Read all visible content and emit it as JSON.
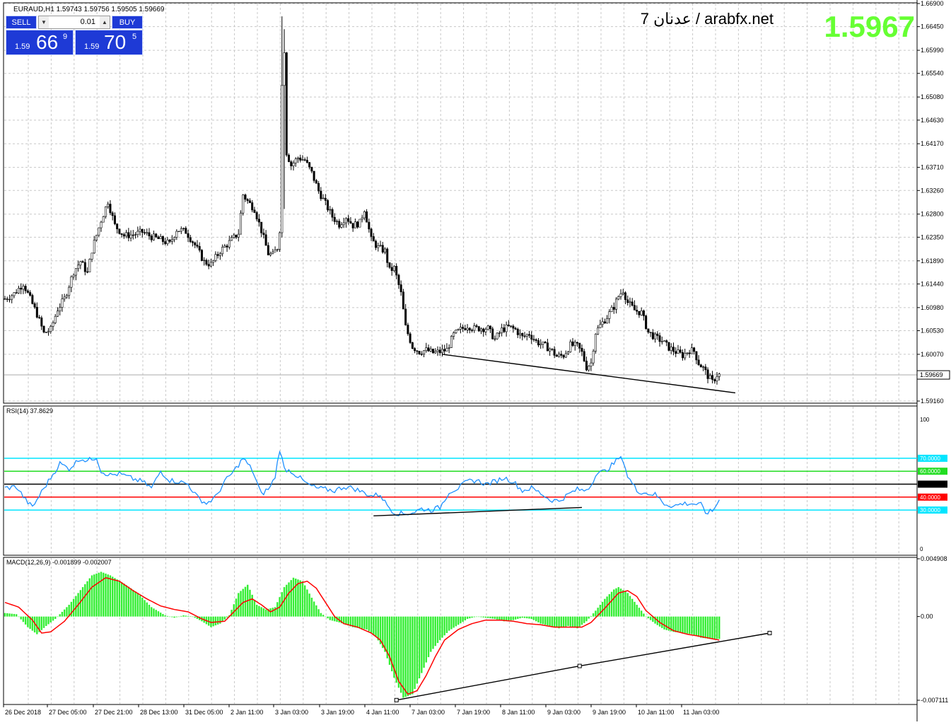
{
  "header": {
    "symbol_info": "EURAUD,H1  1.59743 1.59756 1.59505 1.59669",
    "watermark": "7 عدنان / arabfx.net",
    "big_price": "1.5967"
  },
  "trade_panel": {
    "sell_label": "SELL",
    "buy_label": "BUY",
    "lot": "0.01",
    "sell_prefix": "1.59",
    "sell_big": "66",
    "sell_sup": "9",
    "buy_prefix": "1.59",
    "buy_big": "70",
    "buy_sup": "5"
  },
  "colors": {
    "candle": "#000000",
    "grid": "#c8c8c8",
    "rsi_line": "#1e90ff",
    "level_70": "#00e5ff",
    "level_60": "#22dd22",
    "level_50": "#000000",
    "level_40": "#ff0000",
    "level_30": "#00e5ff",
    "macd_hist": "#33ee33",
    "macd_signal": "#ff0000",
    "big_price": "#66ff33"
  },
  "chart_data": [
    {
      "type": "candlestick",
      "title": "EURAUD,H1",
      "ylim": [
        1.5916,
        1.669
      ],
      "y_ticks": [
        "1.66900",
        "1.66450",
        "1.65990",
        "1.65540",
        "1.65080",
        "1.64630",
        "1.64170",
        "1.63710",
        "1.63260",
        "1.62800",
        "1.62350",
        "1.61890",
        "1.61440",
        "1.60980",
        "1.60530",
        "1.60070",
        "1.59160"
      ],
      "current_price": "1.59669",
      "x_ticks": [
        "26 Dec 2018",
        "27 Dec 05:00",
        "27 Dec 21:00",
        "28 Dec 13:00",
        "31 Dec 05:00",
        "2 Jan 11:00",
        "3 Jan 03:00",
        "3 Jan 19:00",
        "4 Jan 11:00",
        "7 Jan 03:00",
        "7 Jan 19:00",
        "8 Jan 11:00",
        "9 Jan 03:00",
        "9 Jan 19:00",
        "10 Jan 11:00",
        "11 Jan 03:00"
      ],
      "close_path": [
        [
          0,
          1.6115
        ],
        [
          4,
          1.6125
        ],
        [
          8,
          1.6145
        ],
        [
          12,
          1.6105
        ],
        [
          14,
          1.6085
        ],
        [
          17,
          1.6048
        ],
        [
          20,
          1.6055
        ],
        [
          23,
          1.6095
        ],
        [
          26,
          1.6115
        ],
        [
          30,
          1.6168
        ],
        [
          33,
          1.6188
        ],
        [
          36,
          1.6165
        ],
        [
          38,
          1.621
        ],
        [
          42,
          1.6268
        ],
        [
          45,
          1.6305
        ],
        [
          48,
          1.6258
        ],
        [
          52,
          1.6238
        ],
        [
          56,
          1.624
        ],
        [
          60,
          1.6245
        ],
        [
          64,
          1.6236
        ],
        [
          68,
          1.623
        ],
        [
          72,
          1.6222
        ],
        [
          75,
          1.625
        ],
        [
          79,
          1.6246
        ],
        [
          83,
          1.622
        ],
        [
          87,
          1.6187
        ],
        [
          90,
          1.6182
        ],
        [
          94,
          1.6208
        ],
        [
          98,
          1.6225
        ],
        [
          102,
          1.6243
        ],
        [
          104,
          1.6318
        ],
        [
          106,
          1.6305
        ],
        [
          109,
          1.629
        ],
        [
          112,
          1.6248
        ],
        [
          115,
          1.6203
        ],
        [
          117,
          1.62
        ],
        [
          119,
          1.6215
        ],
        [
          120,
          1.625
        ],
        [
          121,
          1.653
        ],
        [
          122,
          1.66
        ],
        [
          123,
          1.64
        ],
        [
          125,
          1.6375
        ],
        [
          128,
          1.639
        ],
        [
          131,
          1.6385
        ],
        [
          134,
          1.636
        ],
        [
          137,
          1.6325
        ],
        [
          140,
          1.63
        ],
        [
          143,
          1.6275
        ],
        [
          146,
          1.626
        ],
        [
          149,
          1.6275
        ],
        [
          152,
          1.6258
        ],
        [
          155,
          1.6263
        ],
        [
          157,
          1.629
        ],
        [
          160,
          1.623
        ],
        [
          163,
          1.6215
        ],
        [
          166,
          1.6208
        ],
        [
          168,
          1.617
        ],
        [
          170,
          1.6175
        ],
        [
          173,
          1.6125
        ],
        [
          175,
          1.606
        ],
        [
          178,
          1.6022
        ],
        [
          181,
          1.6012
        ],
        [
          184,
          1.6015
        ],
        [
          187,
          1.601
        ],
        [
          190,
          1.6012
        ],
        [
          193,
          1.6016
        ],
        [
          196,
          1.6045
        ],
        [
          199,
          1.6055
        ],
        [
          202,
          1.6063
        ],
        [
          205,
          1.6057
        ],
        [
          208,
          1.6058
        ],
        [
          211,
          1.6057
        ],
        [
          214,
          1.6036
        ],
        [
          217,
          1.6055
        ],
        [
          220,
          1.606
        ],
        [
          223,
          1.6055
        ],
        [
          226,
          1.604
        ],
        [
          229,
          1.6047
        ],
        [
          232,
          1.6032
        ],
        [
          235,
          1.6025
        ],
        [
          238,
          1.6018
        ],
        [
          241,
          1.6003
        ],
        [
          244,
          1.6005
        ],
        [
          247,
          1.6025
        ],
        [
          250,
          1.6023
        ],
        [
          252,
          1.601
        ],
        [
          254,
          1.5982
        ],
        [
          256,
          1.599
        ],
        [
          258,
          1.605
        ],
        [
          260,
          1.6063
        ],
        [
          263,
          1.608
        ],
        [
          266,
          1.61
        ],
        [
          268,
          1.612
        ],
        [
          270,
          1.6132
        ],
        [
          272,
          1.6108
        ],
        [
          275,
          1.6093
        ],
        [
          278,
          1.6088
        ],
        [
          281,
          1.605
        ],
        [
          284,
          1.604
        ],
        [
          287,
          1.6033
        ],
        [
          290,
          1.602
        ],
        [
          293,
          1.6012
        ],
        [
          296,
          1.6005
        ],
        [
          299,
          1.6015
        ],
        [
          301,
          1.6013
        ],
        [
          303,
          1.599
        ],
        [
          305,
          1.598
        ],
        [
          307,
          1.5965
        ],
        [
          309,
          1.5953
        ],
        [
          311,
          1.5967
        ]
      ],
      "trendline": [
        [
          191,
          1.6007
        ],
        [
          319,
          1.5932
        ]
      ],
      "horizontal_line": 1.59669
    },
    {
      "type": "line",
      "title": "RSI(14) 37.8629",
      "ylim": [
        0,
        100
      ],
      "y_ticks": [
        "100",
        "70.0000",
        "60.0000",
        "50.0000",
        "40.0000",
        "30.0000",
        "0"
      ],
      "levels": [
        70,
        60,
        50,
        40,
        30
      ],
      "values_path": [
        [
          0,
          47
        ],
        [
          5,
          48
        ],
        [
          9,
          38
        ],
        [
          12,
          32
        ],
        [
          16,
          44
        ],
        [
          20,
          55
        ],
        [
          24,
          66
        ],
        [
          28,
          62
        ],
        [
          33,
          70
        ],
        [
          36,
          68
        ],
        [
          40,
          71
        ],
        [
          42,
          60
        ],
        [
          46,
          57
        ],
        [
          50,
          58
        ],
        [
          56,
          54
        ],
        [
          60,
          52
        ],
        [
          64,
          47
        ],
        [
          68,
          60
        ],
        [
          72,
          53
        ],
        [
          76,
          52
        ],
        [
          80,
          50
        ],
        [
          84,
          40
        ],
        [
          88,
          35
        ],
        [
          92,
          40
        ],
        [
          96,
          52
        ],
        [
          100,
          60
        ],
        [
          104,
          70
        ],
        [
          108,
          61
        ],
        [
          112,
          42
        ],
        [
          116,
          48
        ],
        [
          118,
          56
        ],
        [
          120,
          77
        ],
        [
          122,
          62
        ],
        [
          125,
          60
        ],
        [
          128,
          56
        ],
        [
          132,
          50
        ],
        [
          136,
          47
        ],
        [
          140,
          46
        ],
        [
          144,
          45
        ],
        [
          148,
          48
        ],
        [
          152,
          47
        ],
        [
          156,
          44
        ],
        [
          160,
          41
        ],
        [
          164,
          42
        ],
        [
          166,
          36
        ],
        [
          170,
          28
        ],
        [
          174,
          27
        ],
        [
          178,
          28
        ],
        [
          182,
          31
        ],
        [
          186,
          30
        ],
        [
          190,
          32
        ],
        [
          194,
          44
        ],
        [
          198,
          47
        ],
        [
          202,
          52
        ],
        [
          206,
          53
        ],
        [
          210,
          50
        ],
        [
          214,
          52
        ],
        [
          218,
          55
        ],
        [
          222,
          52
        ],
        [
          226,
          45
        ],
        [
          230,
          47
        ],
        [
          234,
          43
        ],
        [
          238,
          38
        ],
        [
          242,
          37
        ],
        [
          246,
          42
        ],
        [
          250,
          46
        ],
        [
          253,
          45
        ],
        [
          256,
          49
        ],
        [
          258,
          58
        ],
        [
          262,
          60
        ],
        [
          266,
          66
        ],
        [
          268,
          70
        ],
        [
          270,
          69
        ],
        [
          272,
          56
        ],
        [
          276,
          45
        ],
        [
          280,
          43
        ],
        [
          284,
          42
        ],
        [
          288,
          35
        ],
        [
          292,
          33
        ],
        [
          296,
          35
        ],
        [
          300,
          35
        ],
        [
          304,
          34
        ],
        [
          306,
          28
        ],
        [
          309,
          29
        ],
        [
          312,
          37.8629
        ]
      ],
      "trendline": [
        [
          161,
          25.5
        ],
        [
          252,
          32
        ]
      ]
    },
    {
      "type": "bar",
      "title": "MACD(12,26,9) -0.001899 -0.002007",
      "ylim": [
        -0.007111,
        0.004908
      ],
      "y_ticks": [
        "0.004908",
        "0.00",
        "-0.007111"
      ],
      "histogram_path": [
        [
          0,
          0.0003
        ],
        [
          5,
          0.0002
        ],
        [
          10,
          -0.0009
        ],
        [
          14,
          -0.0015
        ],
        [
          18,
          -0.0008
        ],
        [
          22,
          -0.0002
        ],
        [
          28,
          0.001
        ],
        [
          34,
          0.0025
        ],
        [
          38,
          0.0035
        ],
        [
          42,
          0.0038
        ],
        [
          46,
          0.0035
        ],
        [
          52,
          0.0028
        ],
        [
          58,
          0.002
        ],
        [
          64,
          0.0008
        ],
        [
          70,
          0.0001
        ],
        [
          74,
          -0.0001
        ],
        [
          78,
          0.0001
        ],
        [
          82,
          0.0
        ],
        [
          86,
          -0.0004
        ],
        [
          90,
          -0.0009
        ],
        [
          94,
          -0.0006
        ],
        [
          98,
          0.0001
        ],
        [
          102,
          0.002
        ],
        [
          106,
          0.0027
        ],
        [
          110,
          0.001
        ],
        [
          114,
          0.0006
        ],
        [
          118,
          0.0008
        ],
        [
          122,
          0.0025
        ],
        [
          126,
          0.0033
        ],
        [
          130,
          0.003
        ],
        [
          134,
          0.0016
        ],
        [
          138,
          0.0003
        ],
        [
          142,
          -0.0003
        ],
        [
          146,
          -0.0005
        ],
        [
          152,
          -0.0009
        ],
        [
          158,
          -0.0011
        ],
        [
          162,
          -0.0017
        ],
        [
          166,
          -0.003
        ],
        [
          170,
          -0.0052
        ],
        [
          174,
          -0.0069
        ],
        [
          178,
          -0.0066
        ],
        [
          182,
          -0.0048
        ],
        [
          186,
          -0.003
        ],
        [
          190,
          -0.002
        ],
        [
          194,
          -0.0012
        ],
        [
          198,
          -0.0007
        ],
        [
          202,
          -0.0002
        ],
        [
          206,
          0.0
        ],
        [
          210,
          -0.0001
        ],
        [
          214,
          -0.0002
        ],
        [
          218,
          -0.0004
        ],
        [
          222,
          -0.0003
        ],
        [
          226,
          -0.0001
        ],
        [
          230,
          -0.0002
        ],
        [
          234,
          -0.0006
        ],
        [
          238,
          -0.0008
        ],
        [
          242,
          -0.001
        ],
        [
          246,
          -0.0008
        ],
        [
          250,
          -0.001
        ],
        [
          254,
          -0.0004
        ],
        [
          258,
          0.0005
        ],
        [
          262,
          0.0015
        ],
        [
          266,
          0.0023
        ],
        [
          268,
          0.0025
        ],
        [
          272,
          0.002
        ],
        [
          276,
          0.001
        ],
        [
          280,
          0.0
        ],
        [
          284,
          -0.0006
        ],
        [
          288,
          -0.0011
        ],
        [
          292,
          -0.0013
        ],
        [
          296,
          -0.0014
        ],
        [
          300,
          -0.0015
        ],
        [
          304,
          -0.0018
        ],
        [
          308,
          -0.0019
        ],
        [
          312,
          -0.0019
        ]
      ],
      "signal_path": [
        [
          0,
          0.0012
        ],
        [
          6,
          0.0008
        ],
        [
          12,
          -0.0003
        ],
        [
          16,
          -0.0014
        ],
        [
          20,
          -0.0013
        ],
        [
          26,
          -0.0004
        ],
        [
          32,
          0.001
        ],
        [
          38,
          0.0025
        ],
        [
          44,
          0.0033
        ],
        [
          50,
          0.003
        ],
        [
          56,
          0.0022
        ],
        [
          62,
          0.0015
        ],
        [
          68,
          0.0009
        ],
        [
          74,
          0.0006
        ],
        [
          80,
          0.0004
        ],
        [
          86,
          -0.0002
        ],
        [
          90,
          -0.0005
        ],
        [
          96,
          -0.0004
        ],
        [
          100,
          0.0004
        ],
        [
          104,
          0.0012
        ],
        [
          108,
          0.0015
        ],
        [
          112,
          0.001
        ],
        [
          116,
          0.0004
        ],
        [
          120,
          0.0008
        ],
        [
          124,
          0.002
        ],
        [
          128,
          0.0028
        ],
        [
          132,
          0.003
        ],
        [
          136,
          0.0024
        ],
        [
          140,
          0.0012
        ],
        [
          144,
          0.0
        ],
        [
          148,
          -0.0006
        ],
        [
          154,
          -0.0009
        ],
        [
          160,
          -0.0014
        ],
        [
          164,
          -0.002
        ],
        [
          168,
          -0.0034
        ],
        [
          172,
          -0.0055
        ],
        [
          176,
          -0.0066
        ],
        [
          180,
          -0.0063
        ],
        [
          184,
          -0.005
        ],
        [
          188,
          -0.0034
        ],
        [
          192,
          -0.002
        ],
        [
          198,
          -0.0011
        ],
        [
          204,
          -0.0006
        ],
        [
          210,
          -0.0003
        ],
        [
          216,
          -0.0003
        ],
        [
          222,
          -0.0004
        ],
        [
          228,
          -0.0006
        ],
        [
          234,
          -0.0007
        ],
        [
          240,
          -0.0009
        ],
        [
          246,
          -0.0009
        ],
        [
          252,
          -0.0009
        ],
        [
          256,
          -0.0005
        ],
        [
          262,
          0.0007
        ],
        [
          268,
          0.002
        ],
        [
          272,
          0.0022
        ],
        [
          276,
          0.0017
        ],
        [
          280,
          0.0005
        ],
        [
          286,
          -0.0005
        ],
        [
          292,
          -0.0012
        ],
        [
          298,
          -0.0015
        ],
        [
          304,
          -0.0017
        ],
        [
          312,
          -0.002
        ]
      ],
      "trendline": [
        [
          171,
          -0.0071
        ],
        [
          251,
          -0.0042
        ],
        [
          334,
          -0.0014
        ]
      ]
    }
  ]
}
